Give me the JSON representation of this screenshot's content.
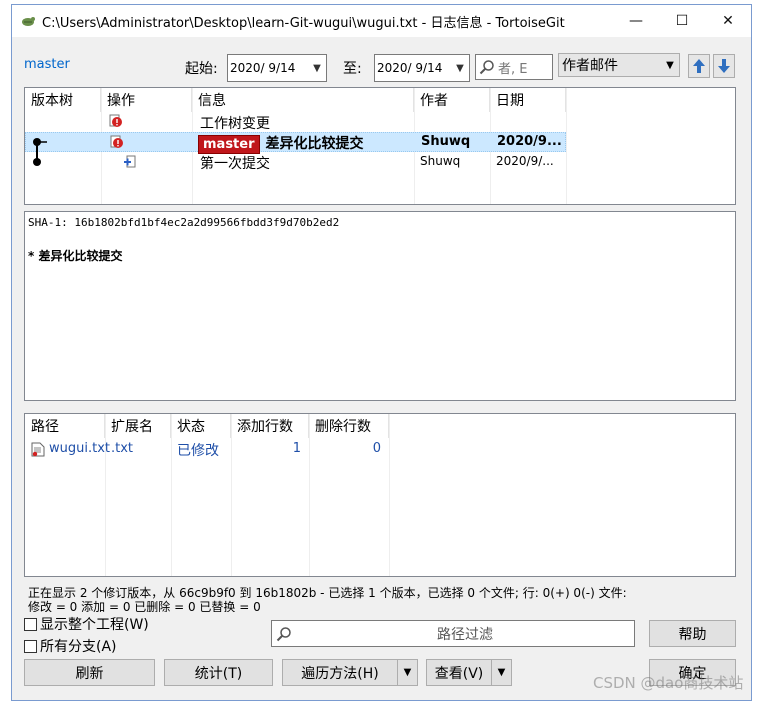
{
  "window": {
    "title": "C:\\Users\\Administrator\\Desktop\\learn-Git-wugui\\wugui.txt - 日志信息 - TortoiseGit",
    "controls": {
      "minimize": "—",
      "maximize": "☐",
      "close": "✕"
    }
  },
  "toolbar": {
    "branch": "master",
    "from_label": "起始:",
    "from_date": "2020/ 9/14",
    "to_label": "至:",
    "to_date": "2020/ 9/14",
    "search_placeholder": "者, E",
    "filter_field": "作者邮件"
  },
  "log_table": {
    "headers": [
      "版本树",
      "操作",
      "信息",
      "作者",
      "日期"
    ],
    "rows": [
      {
        "message": "工作树变更",
        "author": "",
        "date": "",
        "selected": false
      },
      {
        "badge": "master",
        "message": "差异化比较提交",
        "author": "Shuwq",
        "date": "2020/9...",
        "selected": true
      },
      {
        "message": "第一次提交",
        "author": "Shuwq",
        "date": "2020/9/...",
        "selected": false
      }
    ]
  },
  "detail": {
    "sha": "SHA-1: 16b1802bfd1bf4ec2a2d99566fbdd3f9d70b2ed2",
    "bullet": "*",
    "message": "差异化比较提交"
  },
  "files_table": {
    "headers": [
      "路径",
      "扩展名",
      "状态",
      "添加行数",
      "删除行数"
    ],
    "rows": [
      {
        "path": "wugui.txt",
        "ext": ".txt",
        "status": "已修改",
        "added": "1",
        "deleted": "0"
      }
    ]
  },
  "status_bar": {
    "line1": "正在显示 2 个修订版本，从 66c9b9f0 到 16b1802b - 已选择 1 个版本，已选择 0 个文件; 行: 0(+) 0(-) 文件:",
    "line2": "修改 = 0 添加 = 0 已删除 = 0 已替换 = 0"
  },
  "options": {
    "show_whole_project": "显示整个工程(W)",
    "all_branches": "所有分支(A)"
  },
  "path_filter_placeholder": "路径过滤",
  "buttons": {
    "help": "帮助",
    "refresh": "刷新",
    "stats": "统计(T)",
    "walk_method": "遍历方法(H)",
    "view": "查看(V)",
    "ok": "确定"
  },
  "watermark": "CSDN @dao商技术站"
}
